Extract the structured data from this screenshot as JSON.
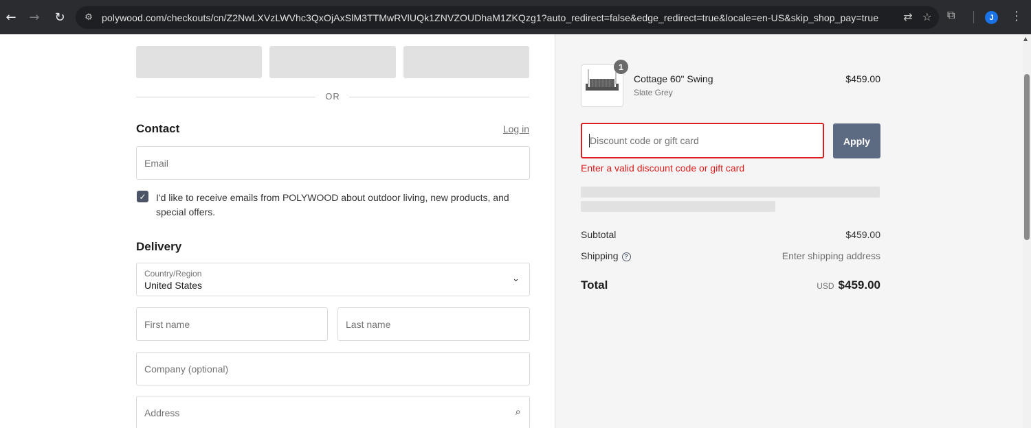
{
  "browser": {
    "url": "polywood.com/checkouts/cn/Z2NwLXVzLWVhc3QxOjAxSlM3TTMwRVlUQk1ZNVZOUDhaM1ZKQzg1?auto_redirect=false&edge_redirect=true&locale=en-US&skip_shop_pay=true",
    "icons": [
      "back-icon",
      "forward-icon",
      "reload-icon",
      "site-info-icon",
      "translate-icon",
      "star-icon",
      "extensions-icon",
      "menu-icon"
    ],
    "profile_initial": "J"
  },
  "checkout": {
    "or_divider": "OR",
    "contact": {
      "title": "Contact",
      "login_link": "Log in",
      "email_placeholder": "Email",
      "marketing_opt_in": "I'd like to receive emails from POLYWOOD about outdoor living, new products, and special offers.",
      "marketing_checked": true
    },
    "delivery": {
      "title": "Delivery",
      "country_label": "Country/Region",
      "country_value": "United States",
      "first_name_placeholder": "First name",
      "last_name_placeholder": "Last name",
      "company_placeholder": "Company (optional)",
      "address_placeholder": "Address"
    }
  },
  "summary": {
    "item": {
      "quantity": "1",
      "name": "Cottage 60\" Swing",
      "variant": "Slate Grey",
      "price": "$459.00"
    },
    "discount": {
      "placeholder": "Discount code or gift card",
      "apply_label": "Apply",
      "error": "Enter a valid discount code or gift card"
    },
    "subtotal_label": "Subtotal",
    "subtotal_value": "$459.00",
    "shipping_label": "Shipping",
    "shipping_value": "Enter shipping address",
    "total_label": "Total",
    "currency": "USD",
    "total_value": "$459.00"
  },
  "colors": {
    "error": "#dd1d1d",
    "apply_button": "#5c6a82",
    "checkbox": "#4c5568"
  }
}
